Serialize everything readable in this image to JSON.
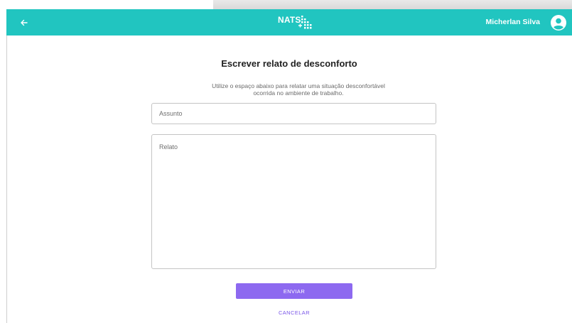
{
  "header": {
    "logo_text": "NATS",
    "user_name": "Micherlan Silva",
    "back_icon": "arrow-left-icon",
    "avatar_icon": "account-circle-icon",
    "background_color": "#21c5c0"
  },
  "form": {
    "title": "Escrever relato de desconforto",
    "description_line1": "Utilize o espaço abaixo para relatar uma situação desconfortável",
    "description_line2": "ocorrida no ambiente de trabalho.",
    "subject_placeholder": "Assunto",
    "report_placeholder": "Relato",
    "send_label": "ENVIAR",
    "cancel_label": "CANCELAR",
    "accent_color": "#8d69f0"
  }
}
